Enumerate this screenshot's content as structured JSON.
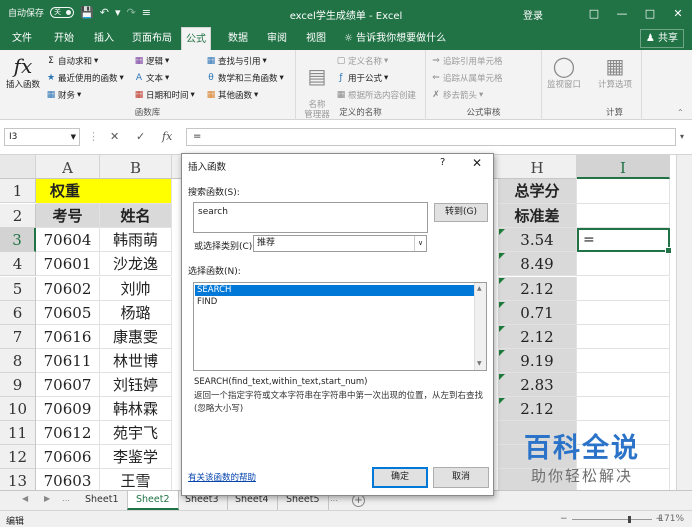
{
  "window": {
    "autosave_label": "自动保存",
    "autosave_state": "关",
    "title": "excel学生成绩单 - Excel",
    "login": "登录"
  },
  "tabs": [
    "文件",
    "开始",
    "插入",
    "页面布局",
    "公式",
    "数据",
    "审阅",
    "视图"
  ],
  "active_tab": "公式",
  "tell_me": "告诉我你想要做什么",
  "share": "共享",
  "ribbon": {
    "insert_function": "插入函数",
    "autosum": "自动求和",
    "recent": "最近使用的函数",
    "financial": "财务",
    "logical": "逻辑",
    "text": "文本",
    "datetime": "日期和时间",
    "lookup": "查找与引用",
    "math": "数学和三角函数",
    "other": "其他函数",
    "library_label": "函数库",
    "name_manager": "名称\n管理器",
    "define_name": "定义名称",
    "use_in_formula": "用于公式",
    "create_from_selection": "根据所选内容创建",
    "defined_names_label": "定义的名称",
    "trace_precedents": "追踪引用单元格",
    "trace_dependents": "追踪从属单元格",
    "remove_arrows": "移去箭头",
    "auditing_label": "公式审核",
    "watch_window": "监视窗口",
    "calc_options": "计算选项",
    "calc_label": "计算"
  },
  "formula_bar": {
    "name_box": "I3",
    "content": "="
  },
  "grid": {
    "columns_left": [
      "A",
      "B"
    ],
    "columns_right": [
      "H",
      "I"
    ],
    "rows": [
      "1",
      "2",
      "3",
      "4",
      "5",
      "6",
      "7",
      "8",
      "9",
      "10",
      "11",
      "12",
      "13"
    ],
    "r1_a": "权重",
    "r2_a": "考号",
    "r2_b": "姓名",
    "r1_h": "总学分",
    "r2_h": "标准差",
    "ids": [
      "70604",
      "70601",
      "70602",
      "70605",
      "70616",
      "70611",
      "70607",
      "70609",
      "70612",
      "70606",
      "70603"
    ],
    "names": [
      "韩雨萌",
      "沙龙逸",
      "刘帅",
      "杨璐",
      "康惠雯",
      "林世博",
      "刘钰婷",
      "韩林霖",
      "苑宇飞",
      "李鉴学",
      "王雪"
    ],
    "std": [
      "3.54",
      "8.49",
      "2.12",
      "0.71",
      "2.12",
      "9.19",
      "2.83",
      "2.12"
    ],
    "active_value": "="
  },
  "sheets": [
    "Sheet1",
    "Sheet2",
    "Sheet3",
    "Sheet4",
    "Sheet5"
  ],
  "active_sheet": "Sheet2",
  "status": {
    "mode": "编辑",
    "zoom": "171%"
  },
  "dialog": {
    "title": "插入函数",
    "help": "?",
    "search_label": "搜索函数(S):",
    "search_value": "search",
    "goto": "转到(G)",
    "category_label": "或选择类别(C):",
    "category": "推荐",
    "select_label": "选择函数(N):",
    "functions": [
      "SEARCH",
      "FIND"
    ],
    "signature": "SEARCH(find_text,within_text,start_num)",
    "description": "返回一个指定字符或文本字符串在字符串中第一次出现的位置，从左到右查找(忽略大小写)",
    "help_link": "有关该函数的帮助",
    "ok": "确定",
    "cancel": "取消"
  },
  "watermark": {
    "line1": "百科全说",
    "line2": "助你轻松解决"
  },
  "colors": {
    "excel_green": "#217346",
    "yellow": "#ffff00",
    "grey_fill": "#d9d9d9",
    "selection_blue": "#0078d7",
    "watermark_blue": "#2a73c9"
  }
}
